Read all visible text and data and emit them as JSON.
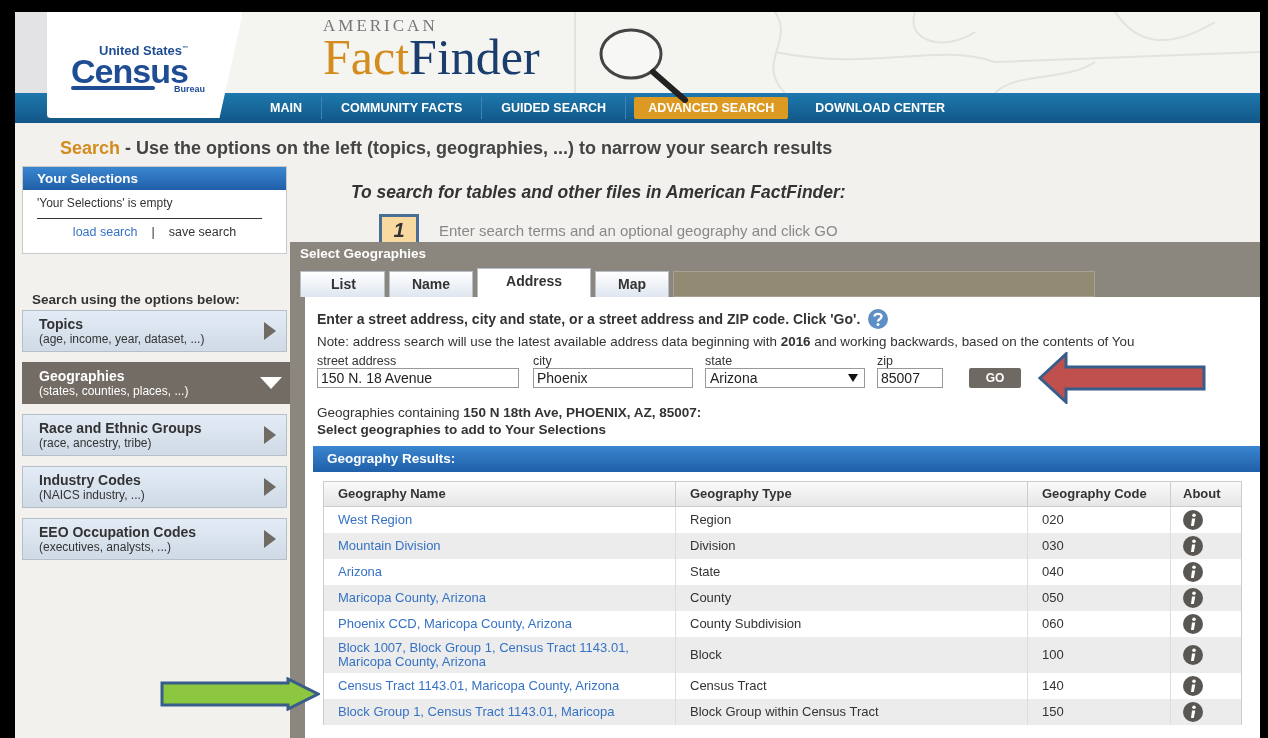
{
  "logo": {
    "top": "United States",
    "tm": "™",
    "main": "Census",
    "sub": "Bureau"
  },
  "brand": {
    "over": "AMERICAN",
    "part1": "Fact",
    "part2": "Finder"
  },
  "nav": [
    {
      "label": "MAIN",
      "selected": false
    },
    {
      "label": "COMMUNITY FACTS",
      "selected": false
    },
    {
      "label": "GUIDED SEARCH",
      "selected": false
    },
    {
      "label": "ADVANCED SEARCH",
      "selected": true
    },
    {
      "label": "DOWNLOAD CENTER",
      "selected": false
    }
  ],
  "heading": {
    "lead": "Search",
    "text": "- Use the options on the left (topics, geographies, ...) to narrow your search results"
  },
  "selections": {
    "title": "Your Selections",
    "empty": "'Your Selections' is empty",
    "load": "load search",
    "separator": "|",
    "save": "save search"
  },
  "options_label": "Search using the options below:",
  "options": [
    {
      "title": "Topics",
      "hint": "(age, income, year, dataset, ...)",
      "expanded": false
    },
    {
      "title": "Geographies",
      "hint": "(states, counties, places, ...)",
      "expanded": true
    },
    {
      "title": "Race and Ethnic Groups",
      "hint": "(race, ancestry, tribe)",
      "expanded": false
    },
    {
      "title": "Industry Codes",
      "hint": "(NAICS industry, ...)",
      "expanded": false
    },
    {
      "title": "EEO Occupation Codes",
      "hint": "(executives, analysts, ...)",
      "expanded": false
    }
  ],
  "main_heading": "To search for tables and other files in American FactFinder:",
  "step": {
    "number": "1",
    "text": "Enter search terms and an optional geography and click GO"
  },
  "dialog": {
    "title": "Select Geographies",
    "tabs": [
      {
        "label": "List",
        "selected": false
      },
      {
        "label": "Name",
        "selected": false
      },
      {
        "label": "Address",
        "selected": true
      },
      {
        "label": "Map",
        "selected": false
      }
    ],
    "instruction": "Enter a street address, city and state, or a street address and ZIP code. Click 'Go'.",
    "note": "Note: address search will use the latest available address data beginning with **2016** and working backwards, based on the contents of You",
    "fields": [
      {
        "label": "street address",
        "value": "150 N. 18 Avenue",
        "kind": "text"
      },
      {
        "label": "city",
        "value": "Phoenix",
        "kind": "text"
      },
      {
        "label": "state",
        "value": "Arizona",
        "kind": "select"
      },
      {
        "label": "zip",
        "value": "85007",
        "kind": "text"
      }
    ],
    "go": "GO",
    "result_line": "Geographies containing **150 N 18th Ave, PHOENIX, AZ, 85007:**",
    "result_hint": "Select geographies to add to Your Selections",
    "results_title": "Geography Results:",
    "columns": [
      "Geography Name",
      "Geography Type",
      "Geography Code",
      "About"
    ],
    "rows": [
      {
        "name": "West Region",
        "type": "Region",
        "code": "020"
      },
      {
        "name": "Mountain Division",
        "type": "Division",
        "code": "030"
      },
      {
        "name": "Arizona",
        "type": "State",
        "code": "040"
      },
      {
        "name": "Maricopa County, Arizona",
        "type": "County",
        "code": "050"
      },
      {
        "name": "Phoenix CCD, Maricopa County, Arizona",
        "type": "County Subdivision",
        "code": "060"
      },
      {
        "name": "Block 1007, Block Group 1, Census Tract 1143.01, Maricopa County, Arizona",
        "type": "Block",
        "code": "100"
      },
      {
        "name": "Census Tract 1143.01, Maricopa County, Arizona",
        "type": "Census Tract",
        "code": "140"
      },
      {
        "name": "Block Group 1, Census Tract 1143.01, Maricopa",
        "type": "Block Group within Census Tract",
        "code": "150"
      }
    ]
  }
}
